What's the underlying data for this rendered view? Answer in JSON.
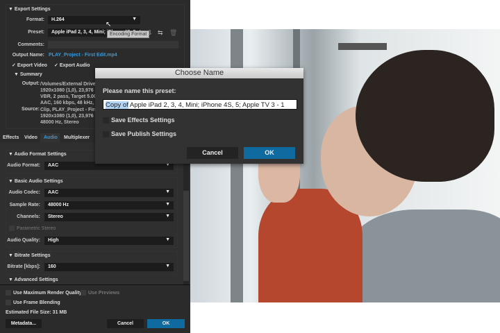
{
  "export_settings": {
    "title": "Export Settings",
    "format_label": "Format:",
    "format_value": "H.264",
    "preset_label": "Preset:",
    "preset_value": "Apple iPad 2, 3, 4, Mini; iPhone 4S, 5; Apple TV 3 - 1",
    "tooltip": "Encoding Format",
    "comments_label": "Comments:",
    "output_name_label": "Output Name:",
    "output_name_value": "PLAY_Project - First Edit.mp4",
    "export_video": "Export Video",
    "export_audio": "Export Audio"
  },
  "summary": {
    "title": "Summary",
    "output_label": "Output:",
    "output_lines": [
      "/Volumes/External Drive/",
      "1920x1080 (1,0), 23,976",
      "VBR, 2 pass, Target 5.00",
      "AAC, 160 kbps, 48 kHz, S"
    ],
    "source_label": "Source:",
    "source_lines": [
      "Clip, PLAY_Project - First",
      "1920x1080 (1,0), 23,976",
      "48000 Hz, Stereo"
    ]
  },
  "tabs": [
    "Effects",
    "Video",
    "Audio",
    "Multiplexer"
  ],
  "audio": {
    "format_section": "Audio Format Settings",
    "format_label": "Audio Format:",
    "format_value": "AAC",
    "basic_section": "Basic Audio Settings",
    "codec_label": "Audio Codec:",
    "codec_value": "AAC",
    "sample_label": "Sample Rate:",
    "sample_value": "48000 Hz",
    "channels_label": "Channels:",
    "channels_value": "Stereo",
    "parametric": "Parametric Stereo",
    "quality_label": "Audio Quality:",
    "quality_value": "High",
    "bitrate_section": "Bitrate Settings",
    "bitrate_label": "Bitrate [kbps]:",
    "bitrate_value": "160",
    "advanced_section": "Advanced Settings"
  },
  "footer": {
    "max_quality": "Use Maximum Render Quality",
    "use_previews": "Use Previews",
    "frame_blending": "Use Frame Blending",
    "file_size": "Estimated File Size:  31 MB",
    "metadata": "Metadata...",
    "cancel": "Cancel",
    "ok": "OK"
  },
  "dialog": {
    "title": "Choose Name",
    "prompt": "Please name this preset:",
    "name_selected": "Copy of",
    "name_rest": " Apple iPad 2, 3, 4, Mini; iPhone 4S, 5; Apple TV 3 - 1",
    "save_effects": "Save Effects Settings",
    "save_publish": "Save Publish Settings",
    "cancel": "Cancel",
    "ok": "OK"
  },
  "colors": {
    "accent": "#0f6aa0",
    "link": "#3a9ad9",
    "panel": "#2b2b2b"
  }
}
